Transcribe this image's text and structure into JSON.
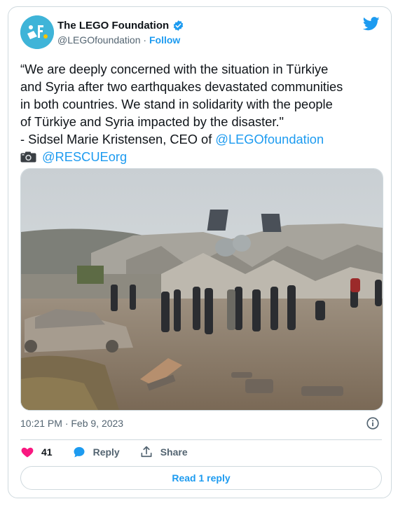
{
  "author": {
    "name": "The LEGO Foundation",
    "handle": "@LEGOfoundation",
    "separator": "·",
    "follow_label": "Follow",
    "verified_icon": "verified-badge-icon"
  },
  "tweet": {
    "lines": [
      "“We are deeply concerned with the situation in Türkiye",
      "and Syria after two earthquakes devastated communities",
      "in both countries. We stand in solidarity with the people",
      "of Türkiye and Syria impacted by the disaster.\""
    ],
    "attribution_prefix": "- Sidsel Marie Kristensen, CEO of ",
    "mention_1": "@LEGOfoundation",
    "mention_2": "@RESCUEorg",
    "camera_icon": "camera-icon"
  },
  "timestamp": "10:21 PM · Feb 9, 2023",
  "actions": {
    "like_count": "41",
    "reply_label": "Reply",
    "share_label": "Share"
  },
  "read_replies_label": "Read 1 reply",
  "colors": {
    "accent": "#1d9bf0",
    "like": "#f91880",
    "text": "#0f1419",
    "secondary": "#536471",
    "border": "#cfd9de"
  }
}
